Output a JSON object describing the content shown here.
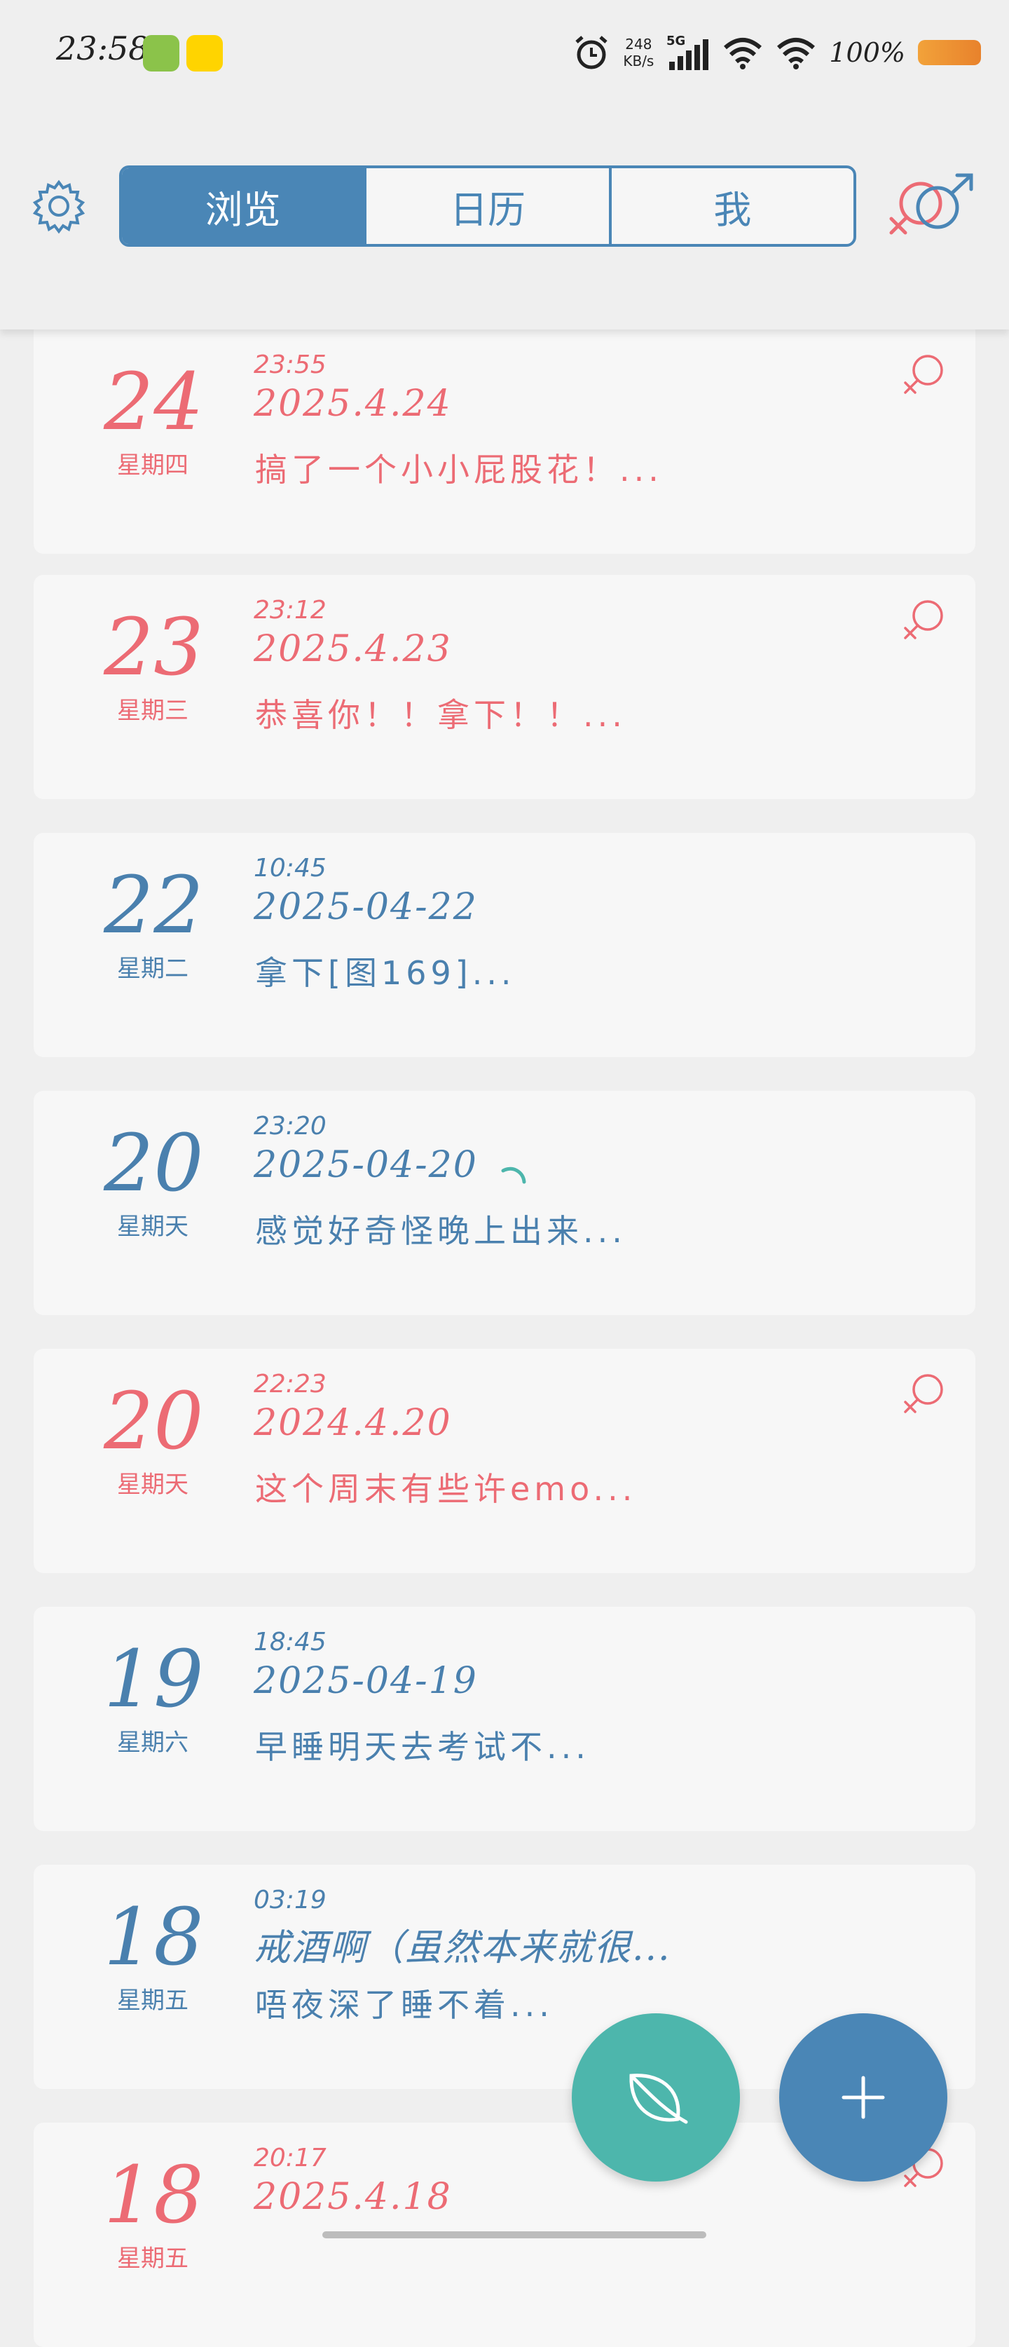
{
  "status_bar": {
    "time": "23:58",
    "net_speed_value": "248",
    "net_speed_unit": "KB/s",
    "network": "5G",
    "battery": "100%"
  },
  "header": {
    "tabs": [
      {
        "label": "浏览",
        "active": true
      },
      {
        "label": "日历",
        "active": false
      },
      {
        "label": "我",
        "active": false
      }
    ],
    "settings_icon": "gear-icon",
    "gender_icon": "gender-symbol-icon"
  },
  "entries": [
    {
      "day": "24",
      "weekday": "星期四",
      "time": "23:55",
      "date": "2025.4.24",
      "preview": "搞了一个小小屁股花！...",
      "color": "#ec6b74",
      "female_icon": true
    },
    {
      "day": "23",
      "weekday": "星期三",
      "time": "23:12",
      "date": "2025.4.23",
      "preview": "恭喜你！！拿下！！...",
      "color": "#ec6b74",
      "female_icon": true
    },
    {
      "day": "22",
      "weekday": "星期二",
      "time": "10:45",
      "date": "2025-04-22",
      "preview": "拿下[图169]...",
      "color": "#4a80ae",
      "female_icon": false
    },
    {
      "day": "20",
      "weekday": "星期天",
      "time": "23:20",
      "date": "2025-04-20",
      "preview": "感觉好奇怪晚上出来...",
      "color": "#4a80ae",
      "female_icon": false
    },
    {
      "day": "20",
      "weekday": "星期天",
      "time": "22:23",
      "date": "2024.4.20",
      "preview": "这个周末有些许emo...",
      "color": "#ec6b74",
      "female_icon": true
    },
    {
      "day": "19",
      "weekday": "星期六",
      "time": "18:45",
      "date": "2025-04-19",
      "preview": "早睡明天去考试不...",
      "color": "#4a80ae",
      "female_icon": false
    },
    {
      "day": "18",
      "weekday": "星期五",
      "time": "03:19",
      "date": "戒酒啊（虽然本来就很...",
      "preview": "唔夜深了睡不着...",
      "color": "#4a80ae",
      "female_icon": false
    },
    {
      "day": "18",
      "weekday": "星期五",
      "time": "20:17",
      "date": "2025.4.18",
      "preview": "",
      "color": "#ec6b74",
      "female_icon": true
    }
  ],
  "fab": {
    "leaf_icon": "leaf-icon",
    "add_icon": "plus-icon"
  }
}
